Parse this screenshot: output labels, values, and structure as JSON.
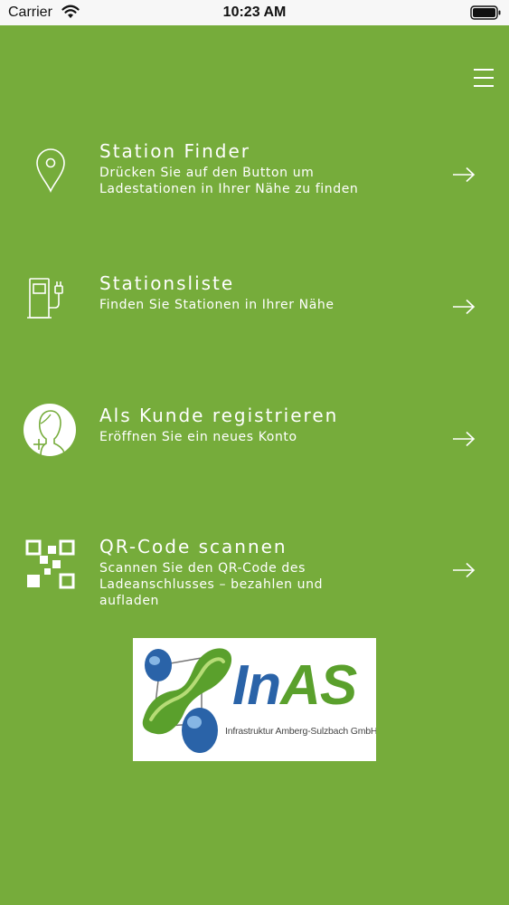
{
  "status_bar": {
    "carrier": "Carrier",
    "time": "10:23 AM"
  },
  "header": {
    "menu_icon": "hamburger-menu-icon"
  },
  "menu": [
    {
      "icon": "location-pin-icon",
      "title": "Station Finder",
      "description": "Drücken Sie auf den Button um Ladestationen in Ihrer Nähe zu finden"
    },
    {
      "icon": "charging-station-icon",
      "title": "Stationsliste",
      "description": "Finden Sie Stationen in Ihrer Nähe"
    },
    {
      "icon": "user-add-icon",
      "title": "Als Kunde registrieren",
      "description": "Eröffnen Sie ein neues Konto"
    },
    {
      "icon": "qr-code-icon",
      "title": "QR-Code scannen",
      "description": "Scannen Sie den QR-Code des Ladeanschlusses – bezahlen und aufladen"
    }
  ],
  "logo": {
    "name_part1": "In",
    "name_part2": "AS",
    "subtitle": "Infrastruktur Amberg-Sulzbach GmbH"
  },
  "colors": {
    "background": "#76ac3b",
    "status_bar": "#f7f7f7",
    "logo_blue": "#2a63a8",
    "logo_green": "#5aa02c"
  }
}
